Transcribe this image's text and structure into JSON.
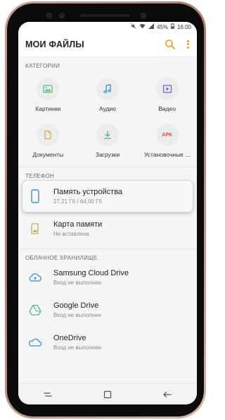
{
  "status_bar": {
    "battery": "45%",
    "time": "16:00",
    "icons": [
      "mute-icon",
      "wifi-icon",
      "signal-icon",
      "battery-icon"
    ]
  },
  "header": {
    "title": "МОИ ФАЙЛЫ",
    "icons": [
      "search-icon",
      "more-vertical-icon"
    ],
    "accent_color": "#e89a1b"
  },
  "categories": {
    "title": "КАТЕГОРИИ",
    "items": [
      {
        "label": "Картинки",
        "icon": "image-icon",
        "color": "#5bbf7a"
      },
      {
        "label": "Аудио",
        "icon": "music-note-icon",
        "color": "#3a8fd6"
      },
      {
        "label": "Видео",
        "icon": "video-icon",
        "color": "#7a5bd6"
      },
      {
        "label": "Документы",
        "icon": "document-icon",
        "color": "#f0a53a"
      },
      {
        "label": "Загрузки",
        "icon": "download-icon",
        "color": "#4fb39c"
      },
      {
        "label": "Установочные ...",
        "icon": "apk-icon",
        "color": "#e0443a",
        "badge": "APK"
      }
    ]
  },
  "phone": {
    "title": "ТЕЛЕФОН",
    "items": [
      {
        "name": "Память устройства",
        "sub": "27,21 Гб / 64,00 Гб",
        "icon": "phone-storage-icon",
        "color": "#3a8fd6"
      },
      {
        "name": "Карта памяти",
        "sub": "Не вставлена",
        "icon": "sd-card-icon",
        "color": "#b8b35a"
      }
    ]
  },
  "cloud": {
    "title": "ОБЛАЧНОЕ ХРАНИЛИЩЕ",
    "items": [
      {
        "name": "Samsung Cloud Drive",
        "sub": "Вход не выполнен",
        "icon": "samsung-cloud-icon",
        "color": "#3a8fd6"
      },
      {
        "name": "Google Drive",
        "sub": "Вход не выполнен",
        "icon": "google-drive-icon",
        "color": "#4fb39c"
      },
      {
        "name": "OneDrive",
        "sub": "Вход не выполнен",
        "icon": "onedrive-icon",
        "color": "#3a8fd6"
      }
    ]
  },
  "nav": {
    "buttons": [
      "recent-apps-icon",
      "home-icon",
      "back-icon"
    ]
  }
}
